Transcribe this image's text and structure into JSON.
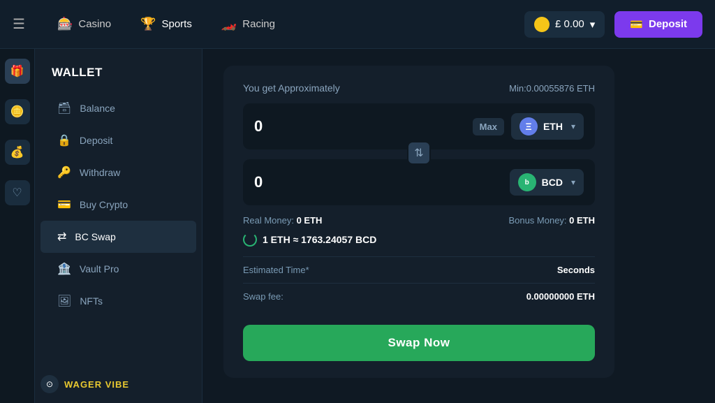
{
  "nav": {
    "hamburger_icon": "☰",
    "items": [
      {
        "id": "casino",
        "label": "Casino",
        "icon": "🎰"
      },
      {
        "id": "sports",
        "label": "Sports",
        "icon": "🏆"
      },
      {
        "id": "racing",
        "label": "Racing",
        "icon": "🏎️"
      }
    ],
    "balance": "£ 0.00",
    "balance_chevron": "▾",
    "deposit_label": "Deposit",
    "deposit_icon": "💳"
  },
  "sidebar_icons": [
    {
      "id": "gift",
      "icon": "🎁"
    },
    {
      "id": "coins",
      "icon": "🪙"
    },
    {
      "id": "coin2",
      "icon": "💰"
    },
    {
      "id": "heart",
      "icon": "♡"
    }
  ],
  "wallet": {
    "title": "WALLET",
    "menu": [
      {
        "id": "balance",
        "label": "Balance",
        "icon": "🗃"
      },
      {
        "id": "deposit",
        "label": "Deposit",
        "icon": "🔒"
      },
      {
        "id": "withdraw",
        "label": "Withdraw",
        "icon": "🔑"
      },
      {
        "id": "buy-crypto",
        "label": "Buy Crypto",
        "icon": "💳"
      },
      {
        "id": "bc-swap",
        "label": "BC Swap",
        "icon": "⇄",
        "active": true
      },
      {
        "id": "vault-pro",
        "label": "Vault Pro",
        "icon": "🏦"
      },
      {
        "id": "nfts",
        "label": "NFTs",
        "icon": "🖼"
      }
    ]
  },
  "swap": {
    "approx_label": "You get Approximately",
    "min_label": "Min:0.00055876 ETH",
    "from_value": "0",
    "to_value": "0",
    "max_button": "Max",
    "from_coin": "ETH",
    "to_coin": "BCD",
    "real_money_label": "Real Money:",
    "real_money_value": "0 ETH",
    "bonus_money_label": "Bonus Money:",
    "bonus_money_value": "0 ETH",
    "exchange_rate": "1 ETH ≈ 1763.24057 BCD",
    "estimated_time_label": "Estimated Time*",
    "estimated_time_value": "Seconds",
    "swap_fee_label": "Swap fee:",
    "swap_fee_value": "0.00000000 ETH",
    "swap_now_button": "Swap Now",
    "swap_arrow_icon": "⇅"
  },
  "brand": {
    "logo": "⊙",
    "name": "WAGER VIBE"
  }
}
